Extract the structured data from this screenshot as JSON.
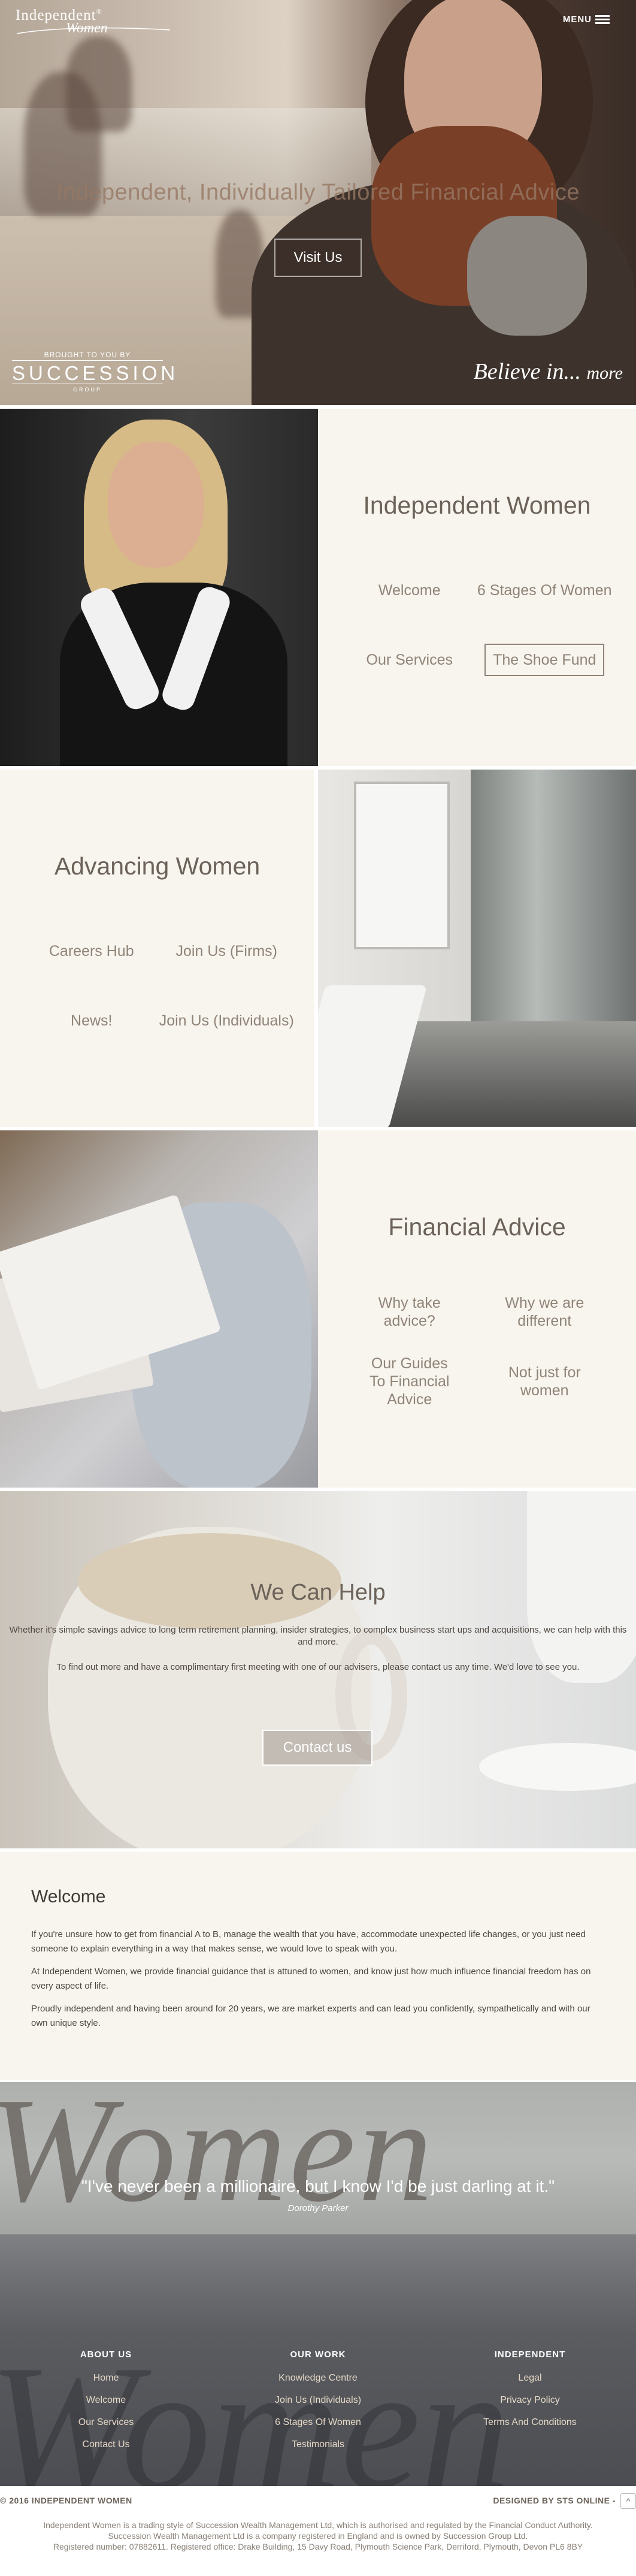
{
  "header": {
    "logo_line1": "Independent",
    "logo_reg": "®",
    "logo_line2": "Women",
    "menu_label": "MENU"
  },
  "hero": {
    "title": "Independent, Individually Tailored Financial Advice",
    "button": "Visit Us",
    "brought_label": "BROUGHT TO YOU BY",
    "brand": "SUCCESSION",
    "brand_sub": "GROUP",
    "tagline": "Believe in...",
    "tagline_more": "more"
  },
  "sections": {
    "independent": {
      "title": "Independent Women",
      "links": [
        "Welcome",
        "6 Stages Of Women",
        "Our Services",
        "The Shoe Fund"
      ]
    },
    "advancing": {
      "title": "Advancing Women",
      "links": [
        "Careers Hub",
        "Join Us (Firms)",
        "News!",
        "Join Us (Individuals)"
      ]
    },
    "advice": {
      "title": "Financial Advice",
      "links": [
        "Why take advice?",
        "Why we are different",
        "Our Guides To Financial Advice",
        "Not just for women"
      ]
    }
  },
  "help": {
    "title": "We Can Help",
    "p1": "Whether it's simple savings advice to long term retirement planning, insider strategies, to complex business start ups and acquisitions, we can help with this and more.",
    "p2": "To find out more and have a complimentary first meeting with one of our advisers, please contact us any time.  We'd love to see you.",
    "button": "Contact us"
  },
  "welcome": {
    "title": "Welcome",
    "paragraphs": [
      "If you're unsure how to get from financial A to B, manage the wealth that you have, accommodate unexpected life changes, or you just need someone to explain everything in a way that makes sense, we would love to speak with you.",
      "At Independent Women, we provide financial guidance that is attuned to women, and know just how much influence financial freedom has on every aspect of life.",
      "Proudly independent and having been around for 20 years, we are market experts and can lead you confidently, sympathetically and with our own unique style."
    ]
  },
  "quote": {
    "backdrop": "Women",
    "text": "\"I've never been a millionaire, but I know I'd be just darling at it.\"",
    "author": "Dorothy Parker"
  },
  "footer": {
    "backdrop": "Women",
    "columns": [
      {
        "heading": "ABOUT US",
        "links": [
          "Home",
          "Welcome",
          "Our Services",
          "Contact Us"
        ]
      },
      {
        "heading": "OUR WORK",
        "links": [
          "Knowledge Centre",
          "Join Us (Individuals)",
          "6 Stages Of Women",
          "Testimonials"
        ]
      },
      {
        "heading": "INDEPENDENT",
        "links": [
          "Legal",
          "Privacy Policy",
          "Terms And Conditions"
        ]
      }
    ],
    "copyright": "© 2016 INDEPENDENT WOMEN",
    "designed_by": "DESIGNED BY STS ONLINE -",
    "to_top": "^",
    "legal_lines": [
      "Independent Women is a trading style of Succession Wealth Management Ltd, which is authorised and regulated by the Financial Conduct Authority.",
      "Succession Wealth Management Ltd is a company registered in England and is owned by Succession Group Ltd.",
      "Registered number: 07882611. Registered office: Drake Building, 15 Davy Road, Plymouth Science Park, Derriford, Plymouth, Devon PL6 8BY"
    ]
  }
}
